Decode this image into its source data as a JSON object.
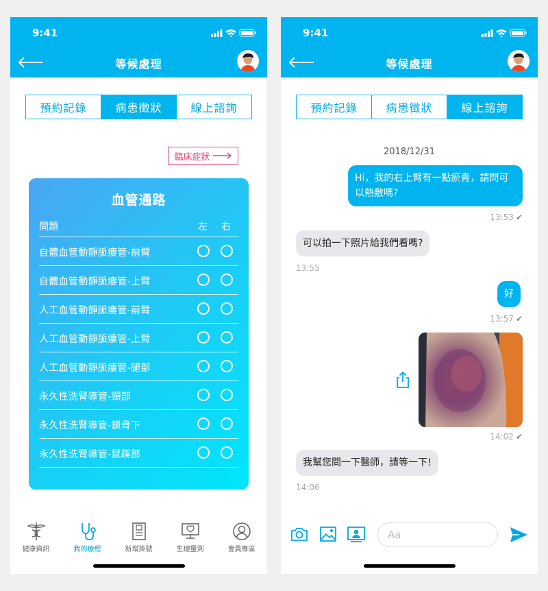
{
  "status_time": "9:41",
  "appbar_title": "等候處理",
  "tabs": [
    "預約記錄",
    "病患徵狀",
    "線上諮詢"
  ],
  "left_screen": {
    "clinical_button": "臨床症狀",
    "card": {
      "title": "血管通路",
      "header_question": "問題",
      "header_left": "左",
      "header_right": "右",
      "rows": [
        "自體血管動靜脈瘻管-前臂",
        "自體血管動靜脈瘻管-上臂",
        "人工血管動靜脈瘻管-前臂",
        "人工血管動靜脈瘻管-上臂",
        "人工血管動靜脈瘻管-腿部",
        "永久性洗腎導管-頸部",
        "永久性洗腎導管-鎖骨下",
        "永久性洗腎導管-鼠蹊部"
      ]
    },
    "nav": [
      "健康資訊",
      "我的療程",
      "新增掛號",
      "生理量測",
      "會員專區"
    ]
  },
  "right_screen": {
    "date": "2018/12/31",
    "messages": [
      {
        "text": "Hi，我的右上臂有一點瘀青，請問可以熱敷嗎?",
        "time": "13:53",
        "check": "✔"
      },
      {
        "text": "可以拍一下照片給我們看嗎?",
        "time": "13:55"
      },
      {
        "text": "好",
        "time": "13:57",
        "check": "✔"
      },
      {
        "time": "14:02",
        "check": "✔"
      },
      {
        "text": "我幫您問一下醫師，請等一下!",
        "time": "14:06"
      }
    ],
    "input_placeholder": "Aa"
  },
  "colors": {
    "accent": "#00b4ef",
    "clinical": "#e0477c",
    "bubble_in": "#e8e8ec"
  }
}
